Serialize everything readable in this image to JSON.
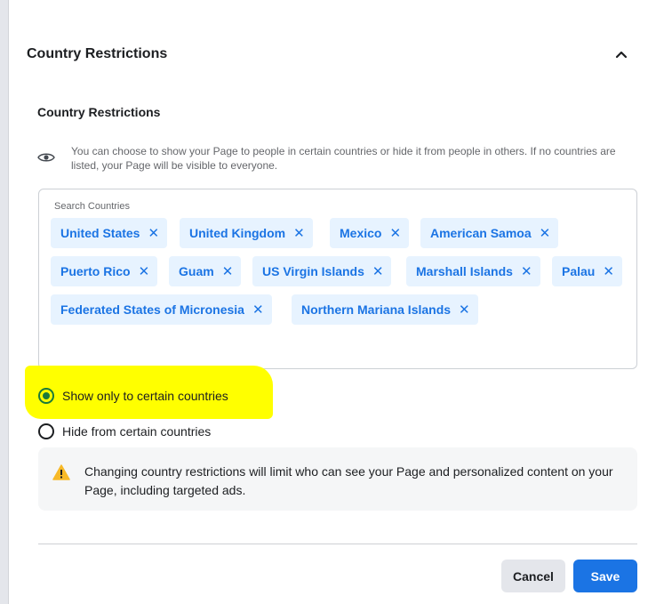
{
  "panel": {
    "header_title": "Country Restrictions",
    "section_title": "Country Restrictions",
    "info_text": "You can choose to show your Page to people in certain countries or hide it from people in others. If no countries are listed, your Page will be visible to everyone."
  },
  "search": {
    "label": "Search Countries",
    "chips": [
      {
        "label": "United States"
      },
      {
        "label": "United Kingdom"
      },
      {
        "label": "Mexico"
      },
      {
        "label": "American Samoa"
      },
      {
        "label": "Puerto Rico"
      },
      {
        "label": "Guam"
      },
      {
        "label": "US Virgin Islands"
      },
      {
        "label": "Marshall Islands"
      },
      {
        "label": "Palau"
      },
      {
        "label": "Federated States of Micronesia"
      },
      {
        "label": "Northern Mariana Islands"
      }
    ],
    "remove_glyph": "✕"
  },
  "options": {
    "show_only": {
      "label": "Show only to certain countries",
      "selected": true
    },
    "hide_from": {
      "label": "Hide from certain countries",
      "selected": false
    }
  },
  "warning": {
    "text": "Changing country restrictions will limit who can see your Page and personalized content on your Page, including targeted ads."
  },
  "buttons": {
    "cancel": "Cancel",
    "save": "Save"
  },
  "colors": {
    "chip_bg": "#e7f3ff",
    "chip_text": "#1b74e4",
    "primary": "#1b74e4",
    "radio_selected": "#1b7a3a",
    "highlight": "#ffff00"
  },
  "icons": {
    "eye": "eye-icon",
    "chevron": "chevron-up-icon",
    "warning": "warning-triangle-icon",
    "remove": "close-icon"
  }
}
